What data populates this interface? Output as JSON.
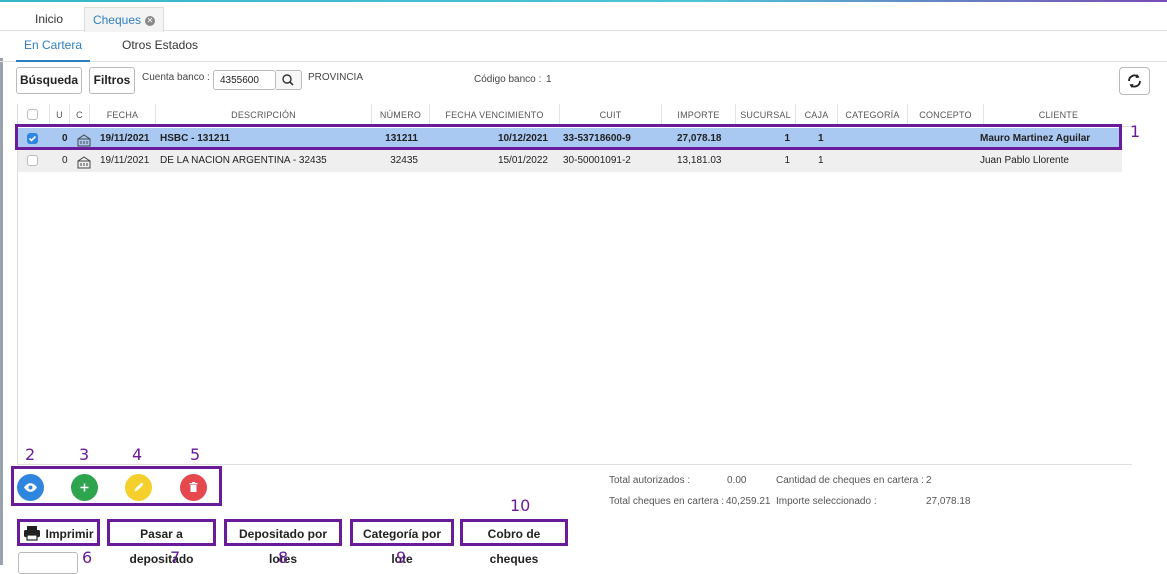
{
  "tabs": {
    "inicio": "Inicio",
    "cheques": "Cheques"
  },
  "subtabs": {
    "active": "En Cartera",
    "other": "Otros Estados"
  },
  "toolbar": {
    "busqueda": "Búsqueda",
    "filtros": "Filtros",
    "cuenta_label": "Cuenta banco :",
    "cuenta_value": "4355600",
    "banco_name": "PROVINCIA",
    "codigo_label": "Código banco :",
    "codigo_value": "1"
  },
  "table": {
    "columns": [
      "U",
      "C",
      "FECHA",
      "DESCRIPCIÓN",
      "NÚMERO",
      "FECHA VENCIMIENTO",
      "CUIT",
      "IMPORTE",
      "SUCURSAL",
      "CAJA",
      "CATEGORÍA",
      "CONCEPTO",
      "CLIENTE"
    ],
    "rows": [
      {
        "selected": true,
        "u": "0",
        "fecha": "19/11/2021",
        "descripcion": "HSBC - 131211",
        "numero": "131211",
        "vencimiento": "10/12/2021",
        "cuit": "33-53718600-9",
        "importe": "27,078.18",
        "sucursal": "1",
        "caja": "1",
        "categoria": "",
        "concepto": "",
        "cliente": "Mauro Martinez Aguilar"
      },
      {
        "selected": false,
        "u": "0",
        "fecha": "19/11/2021",
        "descripcion": "DE LA NACION ARGENTINA - 32435",
        "numero": "32435",
        "vencimiento": "15/01/2022",
        "cuit": "30-50001091-2",
        "importe": "13,181.03",
        "sucursal": "1",
        "caja": "1",
        "categoria": "",
        "concepto": "",
        "cliente": "Juan Pablo Llorente"
      }
    ]
  },
  "summary": {
    "total_autorizados_label": "Total autorizados :",
    "total_autorizados_value": "0.00",
    "cantidad_label": "Cantidad de cheques en cartera :",
    "cantidad_value": "2",
    "total_cartera_label": "Total cheques en cartera :",
    "total_cartera_value": "40,259.21",
    "importe_sel_label": "Importe seleccionado :",
    "importe_sel_value": "27,078.18"
  },
  "actions": {
    "imprimir": "Imprimir",
    "pasar": "Pasar a depositado",
    "depositado_lotes": "Depositado por lotes",
    "categoria_lote": "Categoría por lote",
    "cobro": "Cobro de cheques"
  },
  "annotations": [
    "1",
    "2",
    "3",
    "4",
    "5",
    "6",
    "7",
    "8",
    "9",
    "10"
  ],
  "icons": {
    "view": "eye-icon",
    "add": "plus-icon",
    "edit": "pencil-icon",
    "delete": "trash-icon",
    "print": "printer-icon",
    "refresh": "refresh-icon",
    "search": "search-icon",
    "cheque": "cheque-icon"
  },
  "colors": {
    "accent": "#2e7fc1",
    "highlight": "#6a1b9a",
    "view": "#2e86de",
    "add": "#2ea44f",
    "edit": "#f5cf2b",
    "delete": "#e5484d",
    "selected_row": "#a9c9f2"
  }
}
